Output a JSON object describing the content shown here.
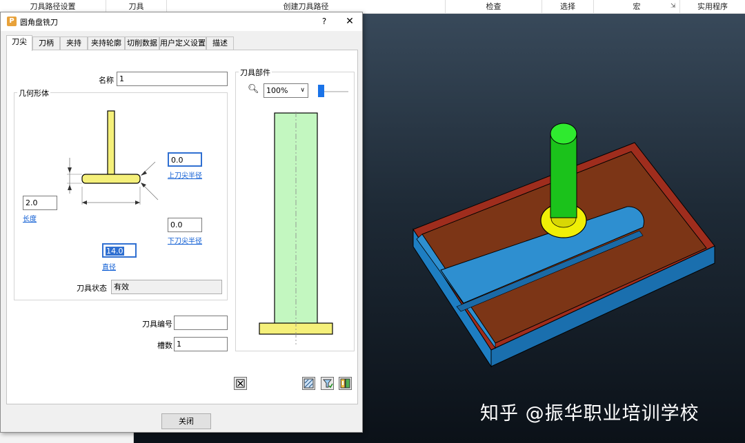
{
  "ribbon": {
    "items": [
      "刀具路径设置",
      "刀具",
      "创建刀具路径",
      "检查",
      "选择",
      "宏",
      "实用程序"
    ],
    "launcher": "⇲"
  },
  "watermark": "知乎 @振华职业培训学校",
  "dialog": {
    "title": "圆角盘铣刀",
    "app_icon_letter": "P",
    "help": "?",
    "close": "✕",
    "tabs": [
      "刀尖",
      "刀柄",
      "夹持",
      "夹持轮廓",
      "切削数据",
      "用户定义设置",
      "描述"
    ],
    "active_tab": 0,
    "name_label": "名称",
    "name_value": "1",
    "geometry_group": "几何形体",
    "upper_radius_value": "0.0",
    "upper_radius_link": "上刀尖半径",
    "length_value": "2.0",
    "length_link": "长度",
    "lower_radius_value": "0.0",
    "lower_radius_link": "下刀尖半径",
    "diameter_value": "14.0",
    "diameter_link": "直径",
    "tool_state_label": "刀具状态",
    "tool_state_value": "有效",
    "tool_number_label": "刀具编号",
    "tool_number_value": "",
    "flutes_label": "槽数",
    "flutes_value": "1",
    "assembly_group": "刀具部件",
    "zoom_value": "100%",
    "close_button": "关闭"
  },
  "colors": {
    "tool_yellow": "#f5f07a",
    "preview_green": "#c3f7c0",
    "stock_blue": "#2e8fd0",
    "floor_brown": "#7c3516",
    "cylinder_green": "#1bc21b",
    "holder_yellow": "#f0ef06"
  }
}
